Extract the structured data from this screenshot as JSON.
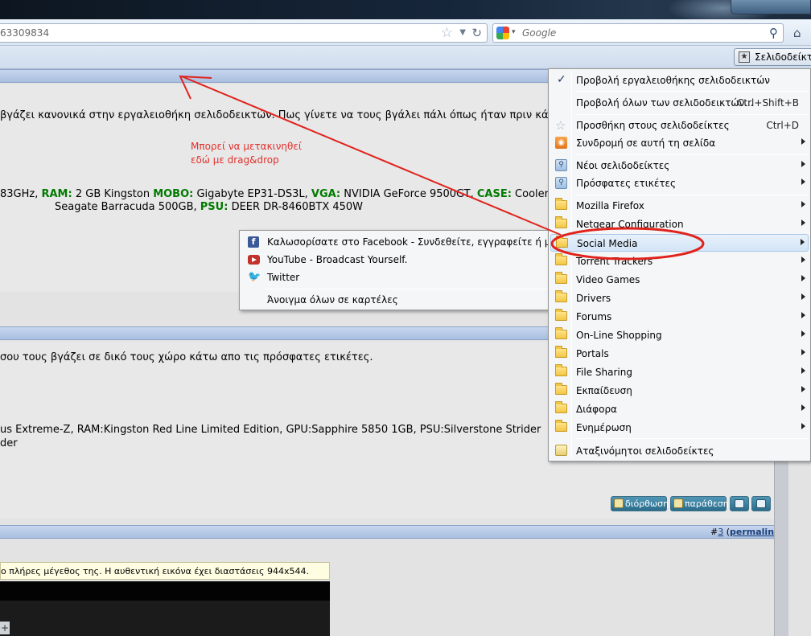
{
  "browser": {
    "url_text": "63309834",
    "search_placeholder": "Google",
    "bookmarks_button": "Σελιδοδείκτες"
  },
  "page": {
    "post1": {
      "line1": "βγάζει κανονικά στην εργαλειοθήκη σελιδοδεικτών. Πως γίνετε να τους βγάλει πάλι όπως ήταν πριν κά",
      "specs": [
        {
          "k": "",
          "v": "83GHz, "
        },
        {
          "k": "RAM:",
          "v": " 2 GB Kingston "
        },
        {
          "k": "MOBO:",
          "v": " Gigabyte EP31-DS3L, "
        },
        {
          "k": "VGA:",
          "v": " NVIDIA GeForce 9500GT, "
        },
        {
          "k": "CASE:",
          "v": " Cooler"
        }
      ],
      "specs2_pre": "Seagate Barracuda 500GB, ",
      "specs2_key": "PSU:",
      "specs2_val": " DEER DR-8460BTX 450W"
    },
    "annotation": [
      "Μπορεί να μετακινηθεί",
      "εδώ με drag&drop"
    ],
    "post2": {
      "line1": "σου τους βγάζει σε δικό τους χώρο κάτω απο τις πρόσφατες ετικέτες.",
      "specs_line": "us Extreme-Z, RAM:Kingston Red Line Limited Edition, GPU:Sapphire 5850 1GB, PSU:Silverstone Strider",
      "specs_line2": "der",
      "edit_button": "διόρθωση",
      "quote_button": "παράθεση"
    },
    "post3": {
      "number_prefix": "#",
      "number": "3",
      "permalink": "permalink",
      "tooltip": "ο πλήρες μέγεθος της. Η αυθεντική εικόνα έχει διαστάσεις 944x544."
    }
  },
  "bookmarks_menu": {
    "items": [
      {
        "label": "Προβολή εργαλειοθήκης σελιδοδεικτών",
        "icon": "checkmark"
      },
      {
        "label": "Προβολή όλων των σελιδοδεικτών...",
        "shortcut": "Ctrl+Shift+B"
      },
      {
        "label": "Προσθήκη στους σελιδοδείκτες",
        "shortcut": "Ctrl+D",
        "icon": "star"
      },
      {
        "label": "Συνδρομή σε αυτή τη σελίδα",
        "icon": "rss"
      },
      {
        "label": "Νέοι σελιδοδείκτες",
        "icon": "smart-folder"
      },
      {
        "label": "Πρόσφατες ετικέτες",
        "icon": "smart-folder"
      },
      {
        "label": "Mozilla Firefox",
        "icon": "folder"
      },
      {
        "label": "Netgear Configuration",
        "icon": "folder"
      },
      {
        "label": "Social Media",
        "icon": "folder"
      },
      {
        "label": "Torrent Trackers",
        "icon": "folder"
      },
      {
        "label": "Video Games",
        "icon": "folder"
      },
      {
        "label": "Drivers",
        "icon": "folder"
      },
      {
        "label": "Forums",
        "icon": "folder"
      },
      {
        "label": "On-Line Shopping",
        "icon": "folder"
      },
      {
        "label": "Portals",
        "icon": "folder"
      },
      {
        "label": "File Sharing",
        "icon": "folder"
      },
      {
        "label": "Εκπαίδευση",
        "icon": "folder"
      },
      {
        "label": "Διάφορα",
        "icon": "folder"
      },
      {
        "label": "Ενημέρωση",
        "icon": "folder"
      },
      {
        "label": "Αταξινόμητοι σελιδοδείκτες",
        "icon": "unsorted"
      }
    ]
  },
  "social_submenu": {
    "items": [
      {
        "label": "Καλωσορίσατε στο Facebook - Συνδεθείτε, εγγραφείτε ή μ...",
        "icon": "facebook"
      },
      {
        "label": "YouTube - Broadcast Yourself.",
        "icon": "youtube"
      },
      {
        "label": "Twitter",
        "icon": "twitter"
      },
      {
        "label": "Άνοιγμα όλων σε καρτέλες"
      }
    ]
  },
  "colors": {
    "annotation": "#e0312c",
    "menu_highlight": "#d4e5f7",
    "post_header": "#b6c9e8",
    "spec_key": "#007a00"
  }
}
